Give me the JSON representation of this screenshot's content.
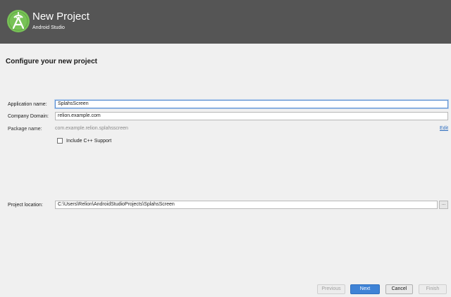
{
  "window": {
    "title": "New Project",
    "subtitle": "Android Studio"
  },
  "page": {
    "heading": "Configure your new project"
  },
  "form": {
    "app_name_label": "Application name:",
    "app_name_value": "SplahsScreen",
    "company_domain_label": "Company Domain:",
    "company_domain_value": "relion.example.com",
    "package_name_label": "Package name:",
    "package_name_value": "com.example.relion.splahsscreen",
    "edit_link": "Edit",
    "cpp_support_label": "Include C++ Support",
    "cpp_support_checked": false,
    "project_location_label": "Project location:",
    "project_location_value": "C:\\Users\\Relion\\AndroidStudioProjects\\SplahsScreen",
    "browse_label": "..."
  },
  "buttons": {
    "previous": "Previous",
    "next": "Next",
    "cancel": "Cancel",
    "finish": "Finish"
  },
  "colors": {
    "header_bg": "#555555",
    "logo_green": "#78c257",
    "primary_button": "#3f83d6",
    "link": "#2a6bbd"
  },
  "icons": {
    "logo": "android-studio-logo-icon"
  }
}
